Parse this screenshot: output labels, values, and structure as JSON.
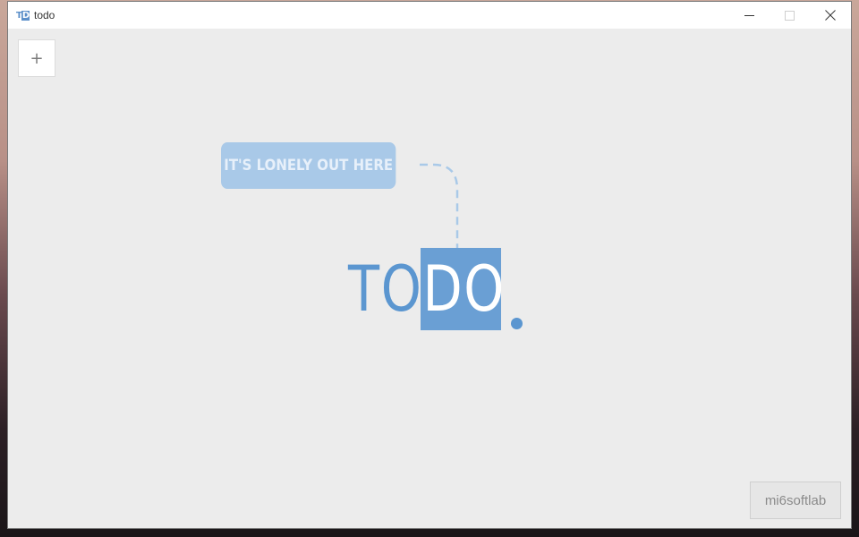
{
  "window": {
    "title": "todo",
    "icon": "todo-app-icon",
    "controls": [
      "minimize-icon",
      "maximize-icon",
      "close-icon"
    ]
  },
  "toolbar": {
    "add_label": "+"
  },
  "empty_state": {
    "bubble_text": "IT'S LONELY OUT HERE",
    "logo_plain": "TO",
    "logo_highlight": "DO"
  },
  "footer": {
    "brand_label": "mi6softlab"
  },
  "colors": {
    "accent": "#5b96d0",
    "accent_box": "#6a9fd4",
    "bubble": "#a9c9e8",
    "background": "#ececec"
  }
}
